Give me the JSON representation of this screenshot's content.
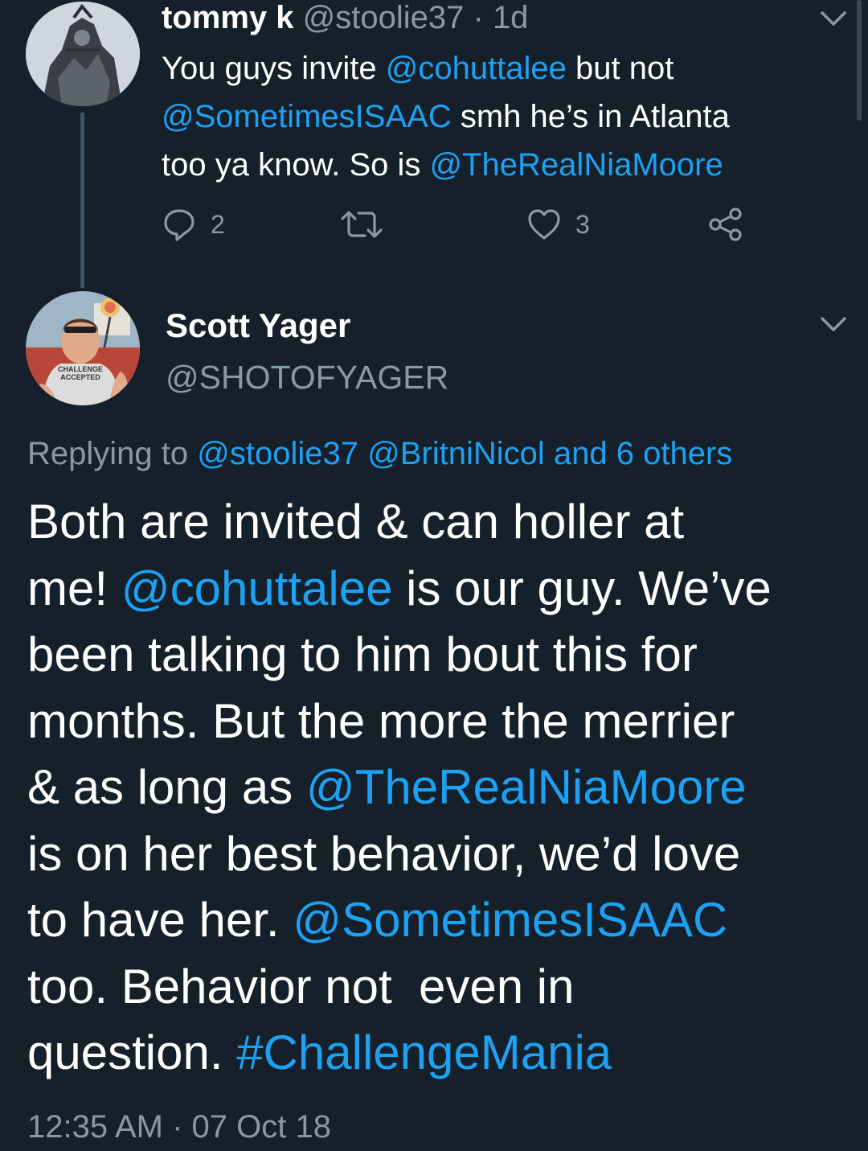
{
  "parent_tweet": {
    "name": "tommy k",
    "handle": "@stoolie37",
    "separator": "·",
    "age": "1d",
    "line1_pre": "You guys invite ",
    "line1_mention": "@cohuttalee",
    "line1_post": " but not",
    "line2_mention": "@SometimesISAAC",
    "line2_post": " smh he’s in Atlanta",
    "line3_pre": "too ya know. So is ",
    "line3_mention": "@TheRealNiaMoore",
    "reply_count": "2",
    "like_count": "3",
    "icons": [
      "reply-icon",
      "retweet-icon",
      "like-icon",
      "share-icon",
      "chevron-down-icon"
    ]
  },
  "main_tweet": {
    "name": "Scott Yager",
    "handle": "@SHOTOFYAGER",
    "replying_label": "Replying to ",
    "replying_mention1": "@stoolie37",
    "replying_mention2": "@BritniNicol",
    "replying_others": "and 6 others",
    "line1": "Both are invited & can holler at",
    "line2_pre": "me! ",
    "line2_mention": "@cohuttalee",
    "line2_post": " is our guy. We’ve",
    "line3": "been talking to him bout this for",
    "line4": "months. But the more the merrier",
    "line5_pre": "& as long as ",
    "line5_mention": "@TheRealNiaMoore",
    "line6": "is on her best behavior, we’d love",
    "line7_pre": "to have her. ",
    "line7_mention": "@SometimesISAAC",
    "line8": "too. Behavior not  even in",
    "line9_pre": "question. ",
    "line9_hashtag": "#ChallengeMania",
    "timestamp": "12:35 AM · 07 Oct 18",
    "avatar_shirt_text": "CHALLENGE ACCEPTED"
  },
  "colors": {
    "background": "#15202b",
    "link": "#1da1f2",
    "secondary_text": "#8899a6",
    "primary_text": "#ffffff",
    "thread_line": "#3d5466"
  }
}
